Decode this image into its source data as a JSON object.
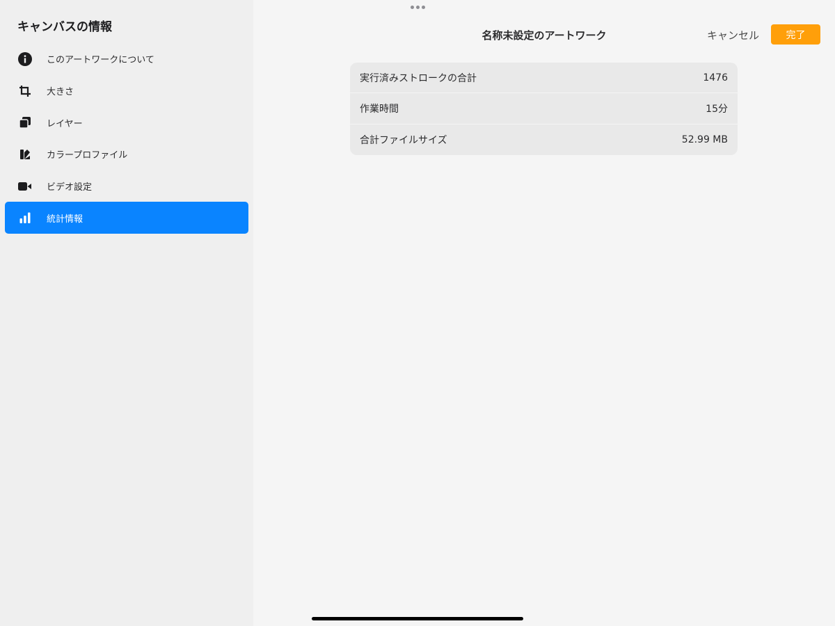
{
  "sidebar": {
    "title": "キャンバスの情報",
    "items": [
      {
        "label": "このアートワークについて",
        "icon": "info-icon",
        "active": false
      },
      {
        "label": "大きさ",
        "icon": "crop-icon",
        "active": false
      },
      {
        "label": "レイヤー",
        "icon": "layers-icon",
        "active": false
      },
      {
        "label": "カラープロファイル",
        "icon": "color-profile-icon",
        "active": false
      },
      {
        "label": "ビデオ設定",
        "icon": "video-camera-icon",
        "active": false
      },
      {
        "label": "統計情報",
        "icon": "bar-chart-icon",
        "active": true
      }
    ]
  },
  "header": {
    "title": "名称未設定のアートワーク",
    "cancel_label": "キャンセル",
    "done_label": "完了"
  },
  "stats": {
    "rows": [
      {
        "label": "実行済みストロークの合計",
        "value": "1476"
      },
      {
        "label": "作業時間",
        "value": "15分"
      },
      {
        "label": "合計ファイルサイズ",
        "value": "52.99 MB"
      }
    ]
  },
  "colors": {
    "accent_blue": "#0a84ff",
    "done_orange": "#ff9f0a",
    "sidebar_bg": "#efefef",
    "main_bg": "#f5f5f5",
    "card_bg": "#e9e9e9"
  }
}
